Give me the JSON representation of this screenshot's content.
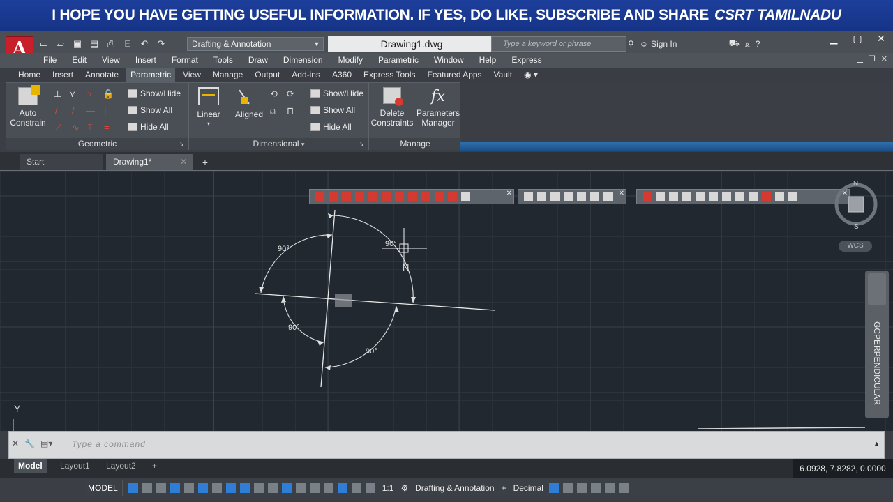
{
  "banner": {
    "message": "I HOPE YOU HAVE GETTING USEFUL INFORMATION. IF YES, DO LIKE, SUBSCRIBE AND SHARE",
    "brand": "CSRT TAMILNADU"
  },
  "titlebar": {
    "app_logo": "A",
    "workspace": "Drafting & Annotation",
    "document": "Drawing1.dwg",
    "search_placeholder": "Type a keyword or phrase",
    "sign_in": "Sign In"
  },
  "menubar": [
    "File",
    "Edit",
    "View",
    "Insert",
    "Format",
    "Tools",
    "Draw",
    "Dimension",
    "Modify",
    "Parametric",
    "Window",
    "Help",
    "Express"
  ],
  "ribbon_tabs": [
    "Home",
    "Insert",
    "Annotate",
    "Parametric",
    "View",
    "Manage",
    "Output",
    "Add-ins",
    "A360",
    "Express Tools",
    "Featured Apps",
    "Vault"
  ],
  "active_ribbon_tab": "Parametric",
  "ribbon": {
    "geometric": {
      "title": "Geometric",
      "auto_constrain": "Auto Constrain",
      "show_hide": "Show/Hide",
      "show_all": "Show All",
      "hide_all": "Hide All"
    },
    "dimensional": {
      "title": "Dimensional",
      "linear": "Linear",
      "aligned": "Aligned",
      "show_hide": "Show/Hide",
      "show_all": "Show All",
      "hide_all": "Hide All"
    },
    "manage": {
      "title": "Manage",
      "delete_constraints": "Delete Constraints",
      "parameters_manager": "Parameters Manager",
      "fx": "fx"
    }
  },
  "file_tabs": {
    "start": "Start",
    "drawing": "Drawing1*"
  },
  "drawing": {
    "angle_labels": [
      "90°",
      "90°",
      "90°",
      "90°"
    ],
    "cursor_glyph": "N"
  },
  "viewcube": {
    "north": "N",
    "south": "S",
    "wcs": "WCS"
  },
  "side_panel": {
    "label": "GCPERPENDICULAR"
  },
  "ucs": {
    "y": "Y"
  },
  "command": {
    "placeholder": "Type a command"
  },
  "layout_tabs": [
    "Model",
    "Layout1",
    "Layout2"
  ],
  "coordinates": "6.0928, 7.8282, 0.0000",
  "status": {
    "model": "MODEL",
    "scale": "1:1",
    "workspace": "Drafting & Annotation",
    "units": "Decimal"
  }
}
